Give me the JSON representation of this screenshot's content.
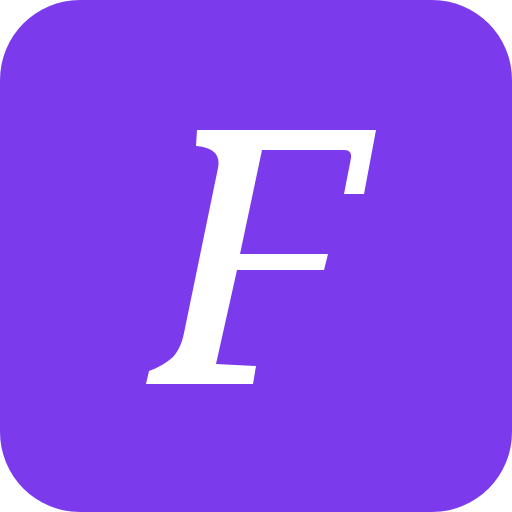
{
  "app_icon": {
    "letter": "F",
    "background_color": "#7b3aec",
    "letter_color": "#ffffff",
    "icon_name": "letter-f-logo-icon"
  }
}
